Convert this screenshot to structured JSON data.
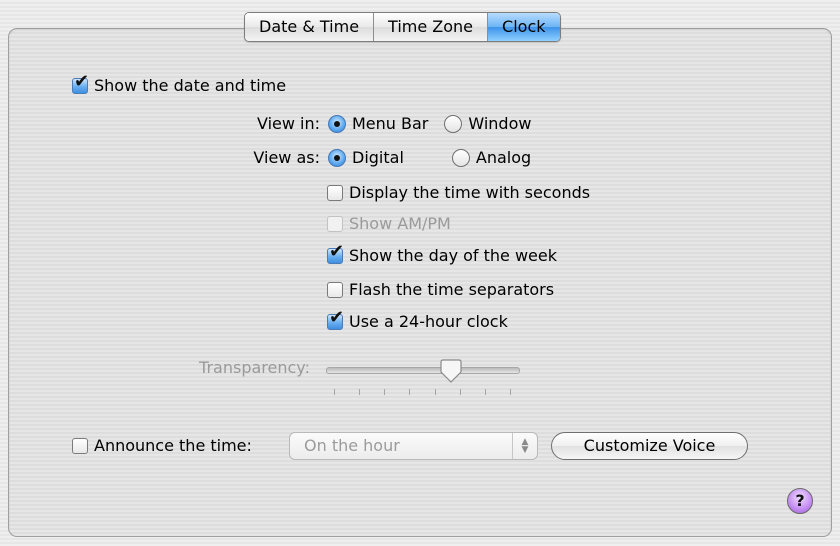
{
  "tabs": [
    "Date & Time",
    "Time Zone",
    "Clock"
  ],
  "active_tab": 2,
  "show_date_time": {
    "label": "Show the date and time",
    "checked": true
  },
  "view_in": {
    "label": "View in:",
    "options": [
      "Menu Bar",
      "Window"
    ],
    "selected": "Menu Bar"
  },
  "view_as": {
    "label": "View as:",
    "options": [
      "Digital",
      "Analog"
    ],
    "selected": "Digital"
  },
  "options": [
    {
      "label": "Display the time with seconds",
      "checked": false,
      "enabled": true
    },
    {
      "label": "Show AM/PM",
      "checked": false,
      "enabled": false
    },
    {
      "label": "Show the day of the week",
      "checked": true,
      "enabled": true
    },
    {
      "label": "Flash the time separators",
      "checked": false,
      "enabled": true
    },
    {
      "label": "Use a 24-hour clock",
      "checked": true,
      "enabled": true
    }
  ],
  "transparency": {
    "label": "Transparency:",
    "value": 0.65,
    "enabled": false
  },
  "announce": {
    "label": "Announce the time:",
    "checked": false,
    "popup_value": "On the hour",
    "button_label": "Customize Voice"
  },
  "help_label": "?",
  "icons": {
    "check": "✔",
    "popup_arrows": "up-down-arrows-icon"
  }
}
